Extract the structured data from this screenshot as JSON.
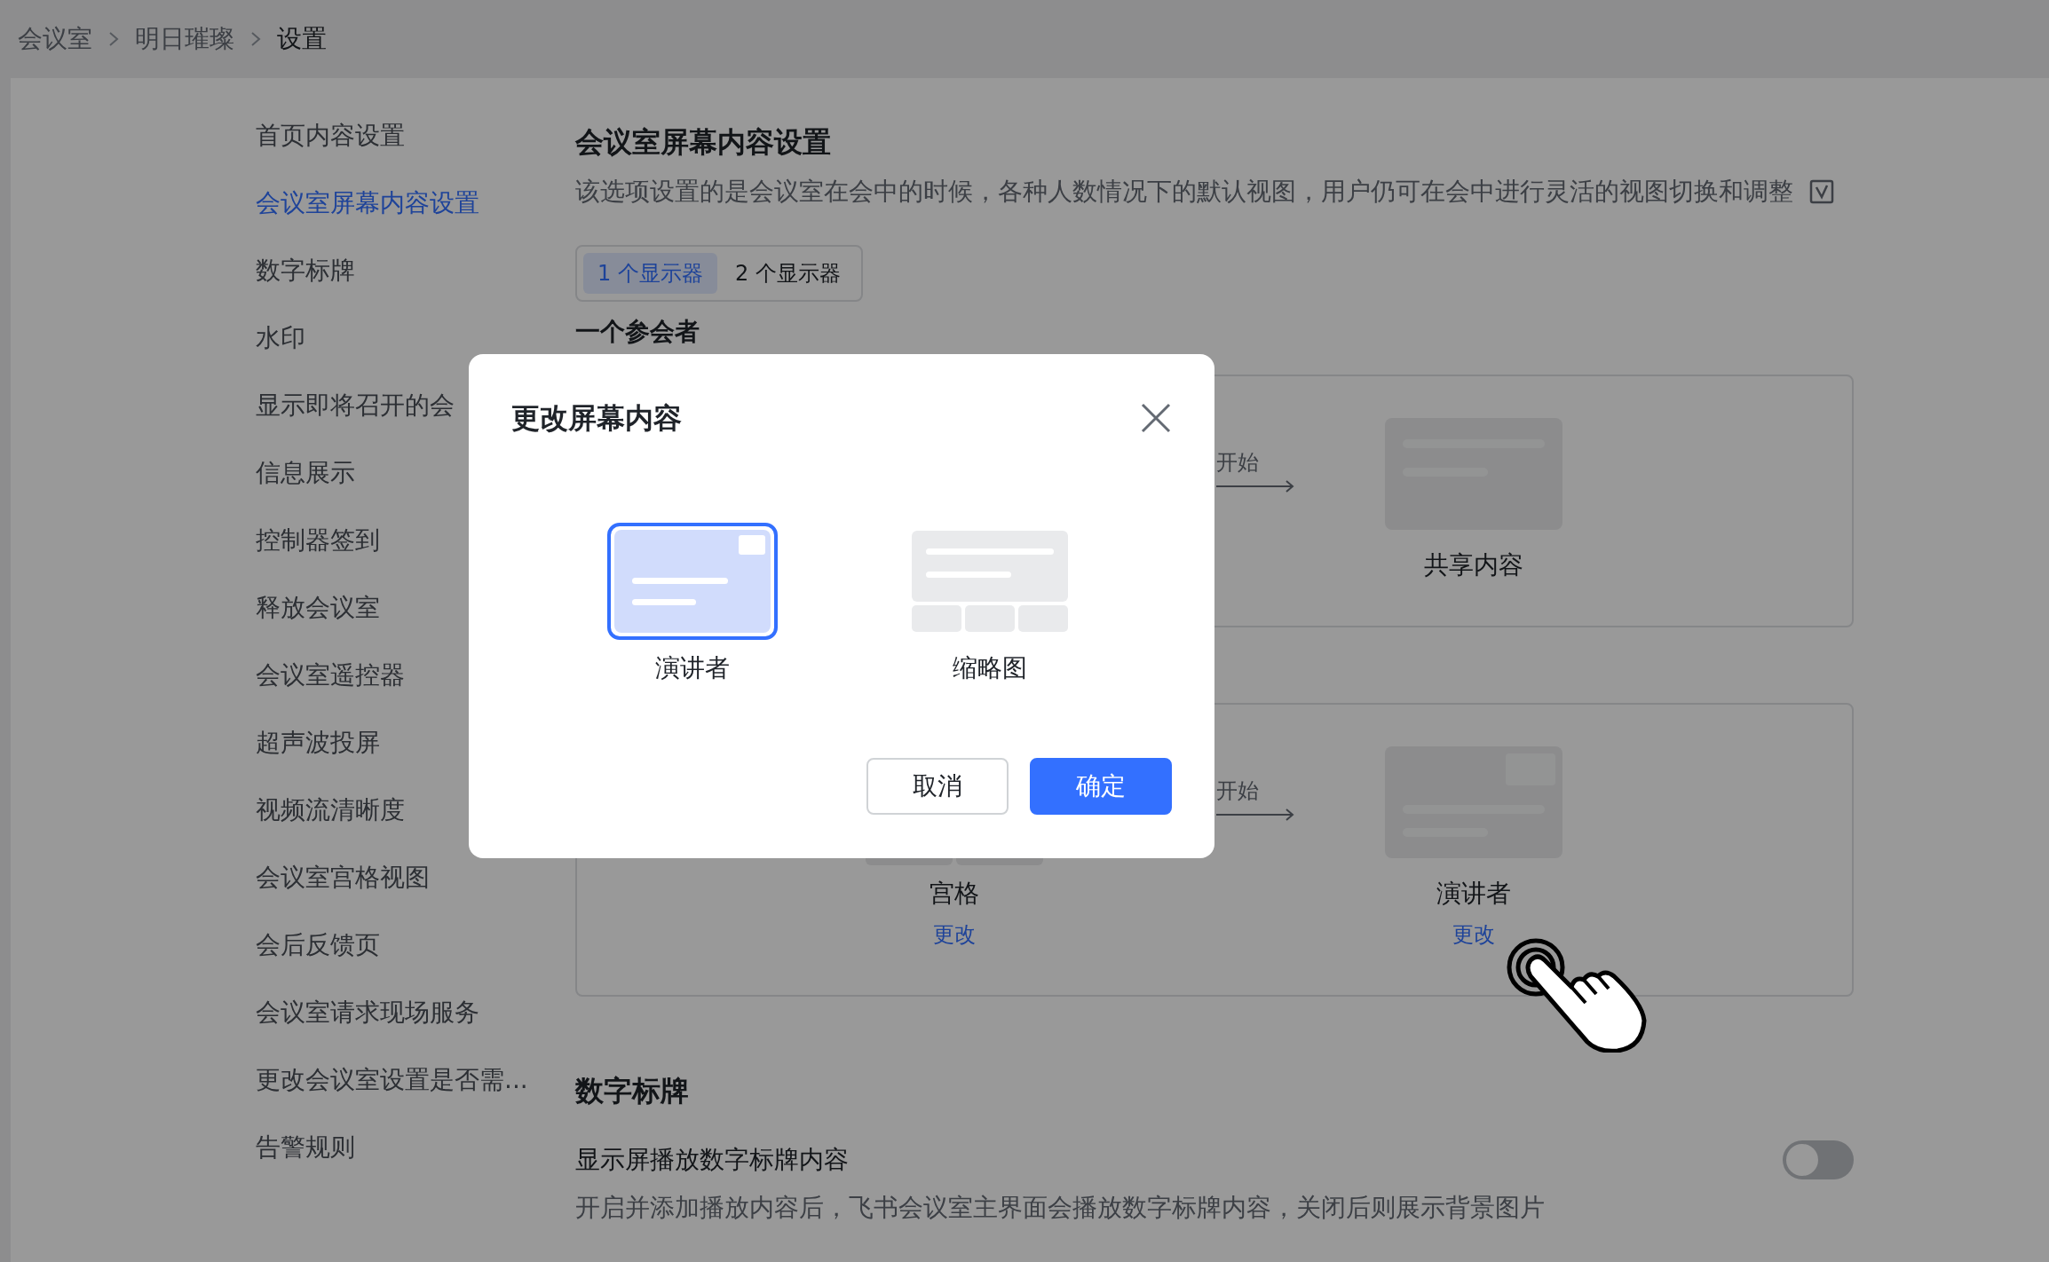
{
  "breadcrumb": [
    {
      "label": "会议室"
    },
    {
      "label": "明日璀璨"
    },
    {
      "label": "设置"
    }
  ],
  "sidebar": {
    "items": [
      {
        "label": "首页内容设置",
        "selected": false
      },
      {
        "label": "会议室屏幕内容设置",
        "selected": true
      },
      {
        "label": "数字标牌",
        "selected": false
      },
      {
        "label": "水印",
        "selected": false
      },
      {
        "label": "显示即将召开的会",
        "selected": false
      },
      {
        "label": "信息展示",
        "selected": false
      },
      {
        "label": "控制器签到",
        "selected": false
      },
      {
        "label": "释放会议室",
        "selected": false
      },
      {
        "label": "会议室遥控器",
        "selected": false
      },
      {
        "label": "超声波投屏",
        "selected": false
      },
      {
        "label": "视频流清晰度",
        "selected": false
      },
      {
        "label": "会议室宫格视图",
        "selected": false
      },
      {
        "label": "会后反馈页",
        "selected": false
      },
      {
        "label": "会议室请求现场服务",
        "selected": false
      },
      {
        "label": "更改会议室设置是否需...",
        "selected": false
      },
      {
        "label": "告警规则",
        "selected": false
      }
    ]
  },
  "screen_content": {
    "title": "会议室屏幕内容设置",
    "description": "该选项设置的是会议室在会中的时候，各种人数情况下的默认视图，用户仍可在会中进行灵活的视图切换和调整",
    "tabs": [
      {
        "label": "1 个显示器",
        "selected": true
      },
      {
        "label": "2 个显示器",
        "selected": false
      }
    ],
    "subheading": "一个参会者",
    "cards": [
      {
        "arrow": {
          "label": "开始"
        },
        "result": {
          "kind": "share",
          "label": "共享内容"
        }
      },
      {
        "source": {
          "kind": "grid",
          "label": "宫格",
          "link": "更改"
        },
        "arrow": {
          "label": "开始"
        },
        "result": {
          "kind": "presenter",
          "label": "演讲者",
          "link": "更改"
        }
      }
    ]
  },
  "digital_signage": {
    "title": "数字标牌",
    "setting": {
      "label": "显示屏播放数字标牌内容",
      "description": "开启并添加播放内容后，飞书会议室主界面会播放数字标牌内容，关闭后则展示背景图片",
      "on": false
    }
  },
  "dialog": {
    "title": "更改屏幕内容",
    "options": [
      {
        "kind": "presenter",
        "label": "演讲者",
        "selected": true
      },
      {
        "kind": "thumbnails",
        "label": "缩略图",
        "selected": false
      }
    ],
    "buttons": [
      {
        "label": "取消",
        "kind": "secondary"
      },
      {
        "label": "确定",
        "kind": "primary"
      }
    ]
  }
}
